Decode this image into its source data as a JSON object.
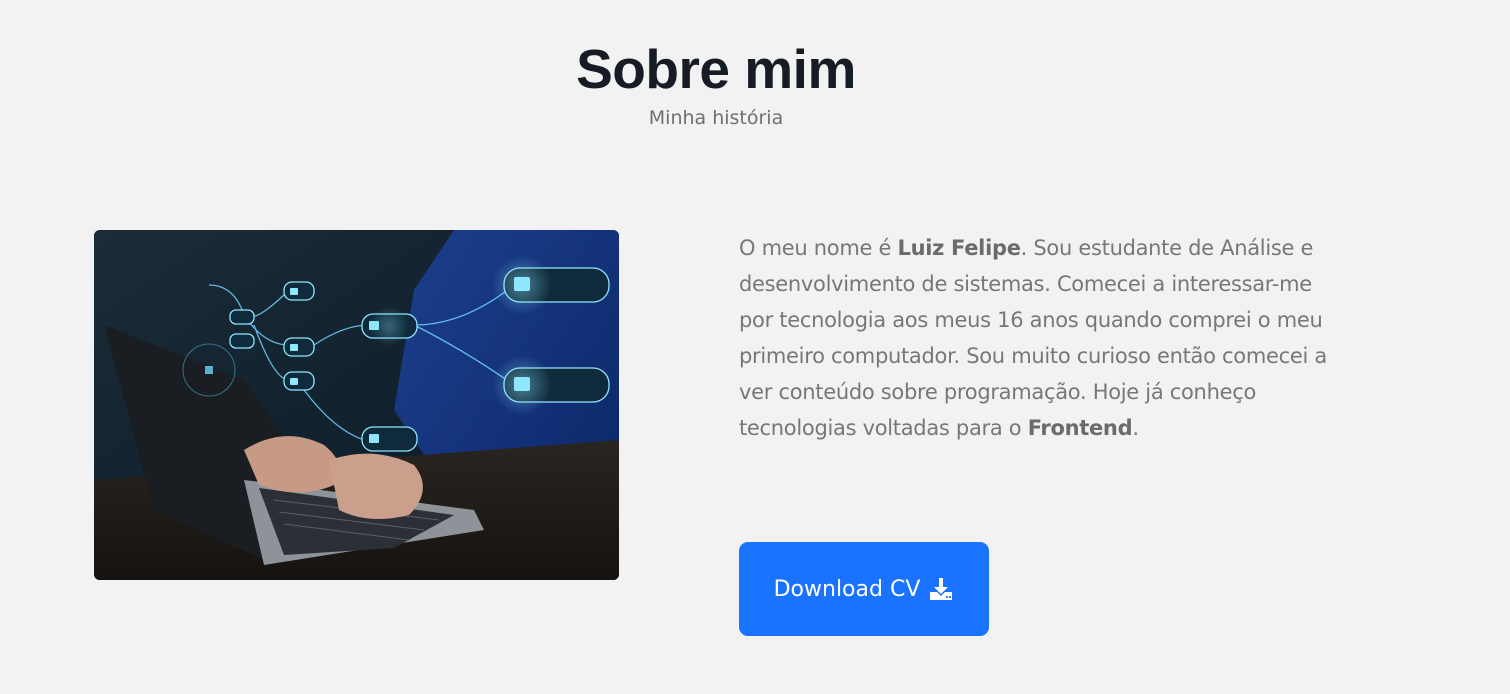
{
  "section": {
    "title": "Sobre mim",
    "subtitle": "Minha história"
  },
  "about": {
    "image_alt": "Pessoa digitando em um notebook com ícones de cadeado digitais",
    "paragraph": {
      "p1": "O meu nome é ",
      "name": "Luiz Felipe",
      "p2": ". Sou estudante de Análise e desenvolvimento de sistemas. Comecei a interessar-me por tecnologia aos meus 16 anos quando comprei o meu primeiro computador. Sou muito curioso então comecei a ver conteúdo sobre programação. Hoje já conheço tecnologias voltadas para o ",
      "focus": "Frontend",
      "p3": "."
    }
  },
  "download": {
    "label": "Download CV",
    "icon": "download-icon"
  },
  "colors": {
    "background": "#f2f2f2",
    "title": "#161b24",
    "text": "#777777",
    "button": "#1a73fe",
    "button_text": "#ffffff"
  }
}
